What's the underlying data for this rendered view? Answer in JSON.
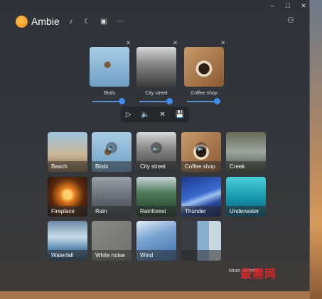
{
  "app": {
    "title": "Ambie"
  },
  "header": {
    "icons": [
      "music-note-icon",
      "moon-icon",
      "screen-icon",
      "more-icon"
    ],
    "user_icon": "user-settings-icon"
  },
  "window_controls": {
    "minimize": "–",
    "maximize": "□",
    "close": "✕"
  },
  "active_sounds": [
    {
      "label": "Birds",
      "volume": 0.75
    },
    {
      "label": "City street",
      "volume": 0.75
    },
    {
      "label": "Coffee shop",
      "volume": 0.75
    }
  ],
  "player": {
    "play": "▷",
    "volume": "🔈",
    "clear": "✕",
    "save": "💾"
  },
  "sounds": [
    {
      "label": "Beach",
      "active": false
    },
    {
      "label": "Birds",
      "active": true
    },
    {
      "label": "City street",
      "active": true
    },
    {
      "label": "Coffee shop",
      "active": true
    },
    {
      "label": "Creek",
      "active": false
    },
    {
      "label": "Fireplace",
      "active": false
    },
    {
      "label": "Rain",
      "active": false
    },
    {
      "label": "Rainforest",
      "active": false
    },
    {
      "label": "Thunder",
      "active": false
    },
    {
      "label": "Underwater",
      "active": false
    },
    {
      "label": "Waterfall",
      "active": false
    },
    {
      "label": "White noise",
      "active": false
    },
    {
      "label": "Wind",
      "active": false
    },
    {
      "label": "",
      "active": false
    }
  ],
  "footer": {
    "more_sounds": "More sounds"
  },
  "watermark": "最需网"
}
